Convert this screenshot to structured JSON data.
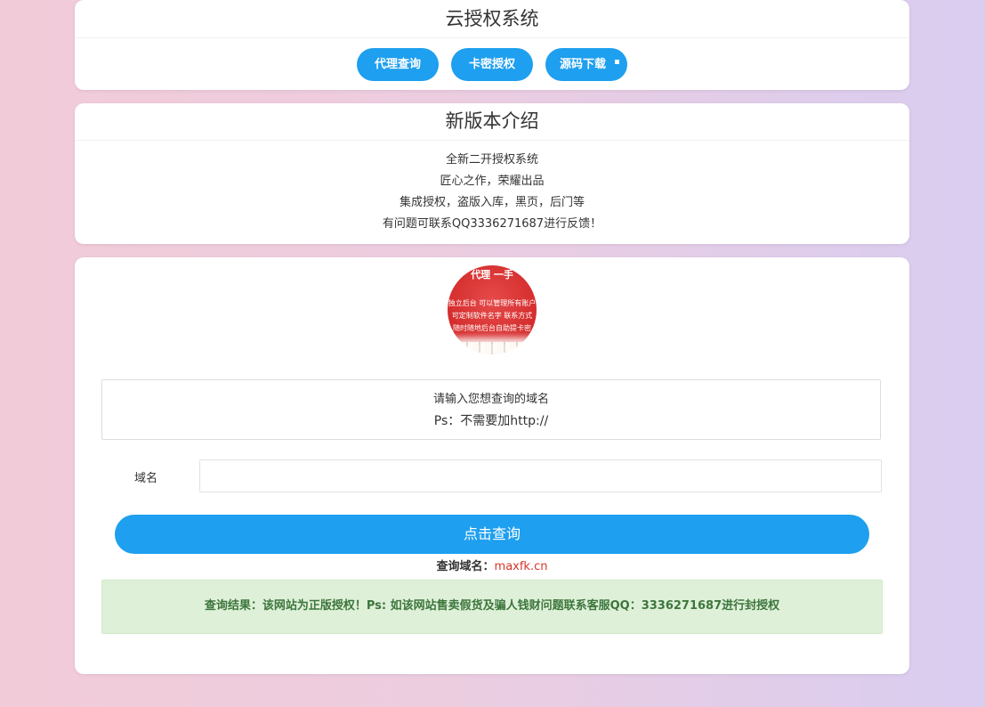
{
  "card1": {
    "title": "云授权系统",
    "buttons": [
      {
        "label": "代理查询"
      },
      {
        "label": "卡密授权"
      },
      {
        "label": "源码下载"
      }
    ]
  },
  "card2": {
    "title": "新版本介绍",
    "lines": [
      "全新二开授权系统",
      "匠心之作，荣耀出品",
      "集成授权，盗版入库，黑页，后门等",
      "有问题可联系QQ3336271687进行反馈！"
    ]
  },
  "card3": {
    "avatar": {
      "top_text": "代理 一手",
      "lines": [
        "独立后台 可以管理所有账户",
        "可定制软件名字 联系方式",
        "随时随地后台自助提卡密"
      ]
    },
    "tip": {
      "line1": "请输入您想查询的域名",
      "line2": "Ps：不需要加http://"
    },
    "domain_label": "域名",
    "domain_input_value": "",
    "query_button": "点击查询",
    "queried_label": "查询域名：",
    "queried_value": "maxfk.cn",
    "result_text": "查询结果：该网站为正版授权！Ps: 如该网站售卖假货及骗人钱财问题联系客服QQ：3336271687进行封授权"
  },
  "colors": {
    "accent": "#1e9fef",
    "success_bg": "#dff0d8",
    "success_text": "#3c763d",
    "domain_value": "#d9342b"
  }
}
